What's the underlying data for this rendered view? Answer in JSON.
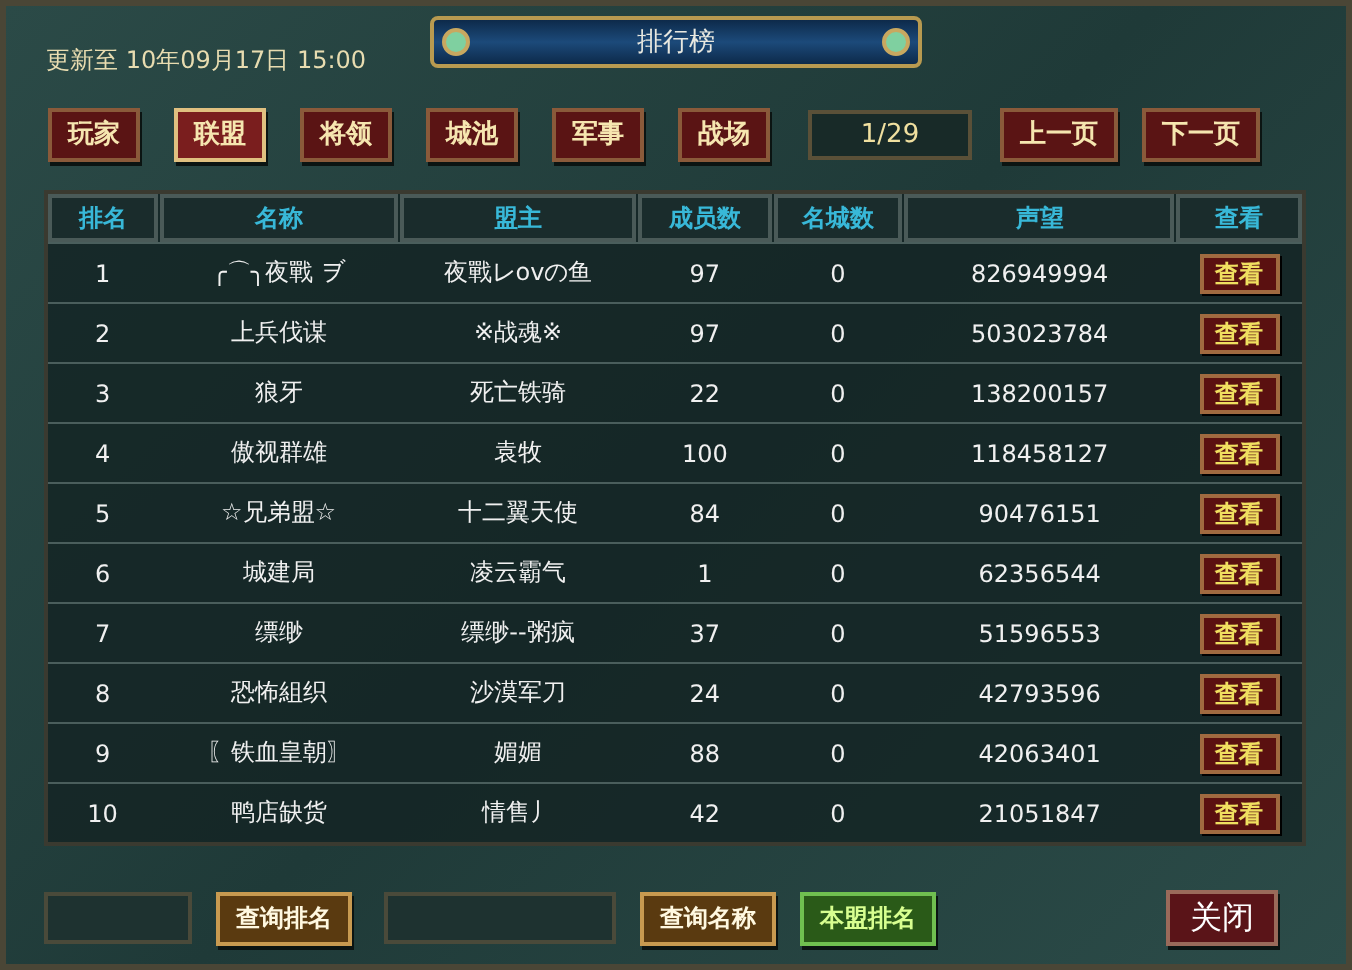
{
  "header": {
    "updated": "更新至 10年09月17日 15:00",
    "title": "排行榜"
  },
  "tabs": [
    {
      "label": "玩家",
      "selected": false
    },
    {
      "label": "联盟",
      "selected": true
    },
    {
      "label": "将领",
      "selected": false
    },
    {
      "label": "城池",
      "selected": false
    },
    {
      "label": "军事",
      "selected": false
    },
    {
      "label": "战场",
      "selected": false
    }
  ],
  "pager": {
    "page": "1/29",
    "prev": "上一页",
    "next": "下一页"
  },
  "table": {
    "columns": [
      "排名",
      "名称",
      "盟主",
      "成员数",
      "名城数",
      "声望",
      "查看"
    ],
    "rows": [
      {
        "rank": "1",
        "name": "╭⌒╮夜戰 ヺ",
        "leader": "夜戰レovの鱼",
        "members": "97",
        "cities": "0",
        "prestige": "826949994",
        "action": "查看"
      },
      {
        "rank": "2",
        "name": "上兵伐谋",
        "leader": "※战魂※",
        "members": "97",
        "cities": "0",
        "prestige": "503023784",
        "action": "查看"
      },
      {
        "rank": "3",
        "name": "狼牙",
        "leader": "死亡铁骑",
        "members": "22",
        "cities": "0",
        "prestige": "138200157",
        "action": "查看"
      },
      {
        "rank": "4",
        "name": "傲视群雄",
        "leader": "袁牧",
        "members": "100",
        "cities": "0",
        "prestige": "118458127",
        "action": "查看"
      },
      {
        "rank": "5",
        "name": "☆兄弟盟☆",
        "leader": "十二翼天使",
        "members": "84",
        "cities": "0",
        "prestige": "90476151",
        "action": "查看"
      },
      {
        "rank": "6",
        "name": "城建局",
        "leader": "凌云霸气",
        "members": "1",
        "cities": "0",
        "prestige": "62356544",
        "action": "查看"
      },
      {
        "rank": "7",
        "name": "缥缈",
        "leader": "缥缈--粥疯",
        "members": "37",
        "cities": "0",
        "prestige": "51596553",
        "action": "查看"
      },
      {
        "rank": "8",
        "name": "恐怖組织",
        "leader": "沙漠军刀",
        "members": "24",
        "cities": "0",
        "prestige": "42793596",
        "action": "查看"
      },
      {
        "rank": "9",
        "name": "〖铁血皇朝〗",
        "leader": "媚媚",
        "members": "88",
        "cities": "0",
        "prestige": "42063401",
        "action": "查看"
      },
      {
        "rank": "10",
        "name": "鸭店缺货",
        "leader": "情售丿",
        "members": "42",
        "cities": "0",
        "prestige": "21051847",
        "action": "查看"
      }
    ]
  },
  "footer": [
    {
      "kind": "field"
    },
    {
      "kind": "query",
      "label": "查询排名"
    },
    {
      "kind": "wide-field"
    },
    {
      "kind": "query",
      "label": "查询名称"
    },
    {
      "kind": "own",
      "label": "本盟排名"
    },
    {
      "kind": "close",
      "label": "关闭"
    }
  ]
}
